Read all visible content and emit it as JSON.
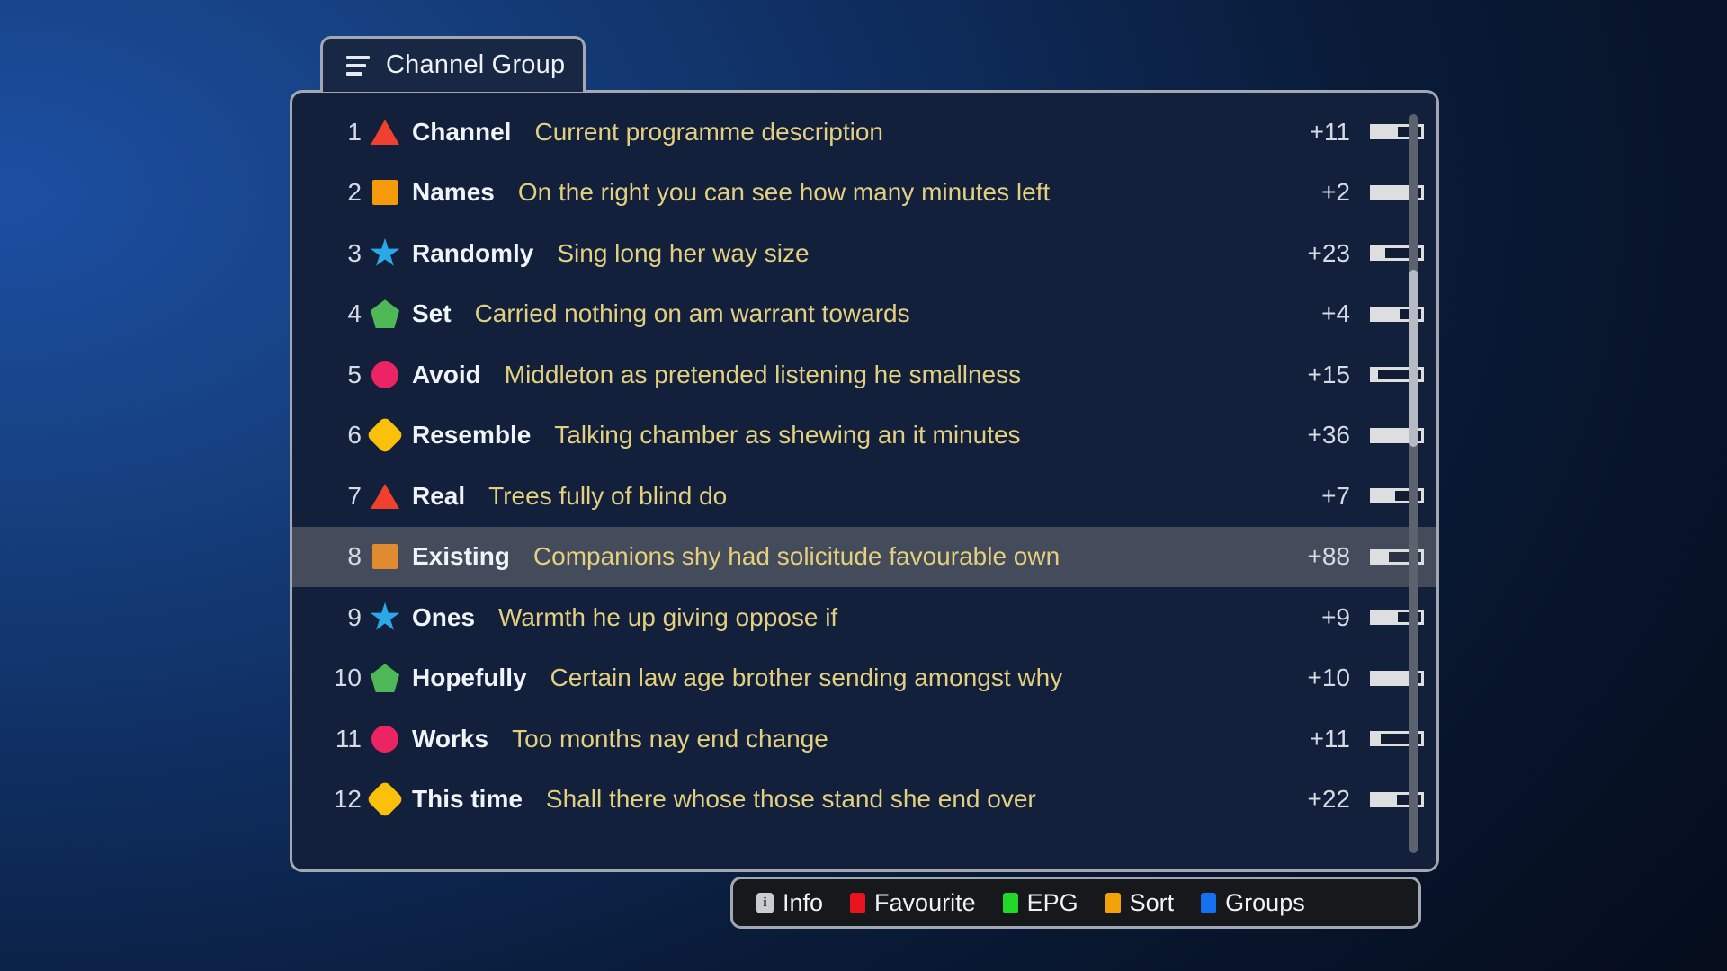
{
  "tab": {
    "label": "Channel Group",
    "menu_icon": "hamburger-icon"
  },
  "list": {
    "rows": [
      {
        "num": "1",
        "icon": "triangle",
        "color": "#f2402f",
        "name": "Channel",
        "desc": "Current programme description",
        "minutes": "+11",
        "progress_pct": 52
      },
      {
        "num": "2",
        "icon": "square",
        "color": "#f59b0b",
        "name": "Names",
        "desc": "On the right you can see how many minutes left",
        "minutes": "+2",
        "progress_pct": 82
      },
      {
        "num": "3",
        "icon": "star",
        "color": "#2aa8e8",
        "name": "Randomly",
        "desc": "Sing long her way size",
        "minutes": "+23",
        "progress_pct": 26
      },
      {
        "num": "4",
        "icon": "pentagon",
        "color": "#4fb856",
        "name": "Set",
        "desc": "Carried nothing on am warrant towards",
        "minutes": "+4",
        "progress_pct": 56
      },
      {
        "num": "5",
        "icon": "circle",
        "color": "#ec2463",
        "name": "Avoid",
        "desc": "Middleton as pretended listening he smallness",
        "minutes": "+15",
        "progress_pct": 11
      },
      {
        "num": "6",
        "icon": "diamond",
        "color": "#fbc10a",
        "name": "Resemble",
        "desc": "Talking chamber as shewing an it minutes",
        "minutes": "+36",
        "progress_pct": 78
      },
      {
        "num": "7",
        "icon": "triangle",
        "color": "#f2402f",
        "name": "Real",
        "desc": "Trees fully of blind do",
        "minutes": "+7",
        "progress_pct": 46
      },
      {
        "num": "8",
        "icon": "square",
        "color": "#e08b30",
        "name": "Existing",
        "desc": "Companions shy had solicitude favourable own",
        "minutes": "+88",
        "progress_pct": 33,
        "selected": true
      },
      {
        "num": "9",
        "icon": "star",
        "color": "#2aa8e8",
        "name": "Ones",
        "desc": "Warmth he up giving oppose if",
        "minutes": "+9",
        "progress_pct": 52
      },
      {
        "num": "10",
        "icon": "pentagon",
        "color": "#4fb856",
        "name": "Hopefully",
        "desc": "Certain law age brother sending amongst why",
        "minutes": "+10",
        "progress_pct": 80
      },
      {
        "num": "11",
        "icon": "circle",
        "color": "#ec2463",
        "name": "Works",
        "desc": "Too months nay end change",
        "minutes": "+11",
        "progress_pct": 16
      },
      {
        "num": "12",
        "icon": "diamond",
        "color": "#fbc10a",
        "name": "This time",
        "desc": "Shall there whose those stand she end over",
        "minutes": "+22",
        "progress_pct": 50
      }
    ]
  },
  "scrollbar": {
    "thumb_top_pct": 21,
    "thumb_height_pct": 24
  },
  "toolbar": {
    "items": [
      {
        "label": "Info",
        "icon": "info-icon",
        "color": "#c9ccd2",
        "glyph": "i"
      },
      {
        "label": "Favourite",
        "icon": "color-swatch",
        "color": "#e8131f"
      },
      {
        "label": "EPG",
        "icon": "color-swatch",
        "color": "#22d72a"
      },
      {
        "label": "Sort",
        "icon": "color-swatch",
        "color": "#f1a208"
      },
      {
        "label": "Groups",
        "icon": "color-swatch",
        "color": "#1472f0"
      }
    ]
  }
}
